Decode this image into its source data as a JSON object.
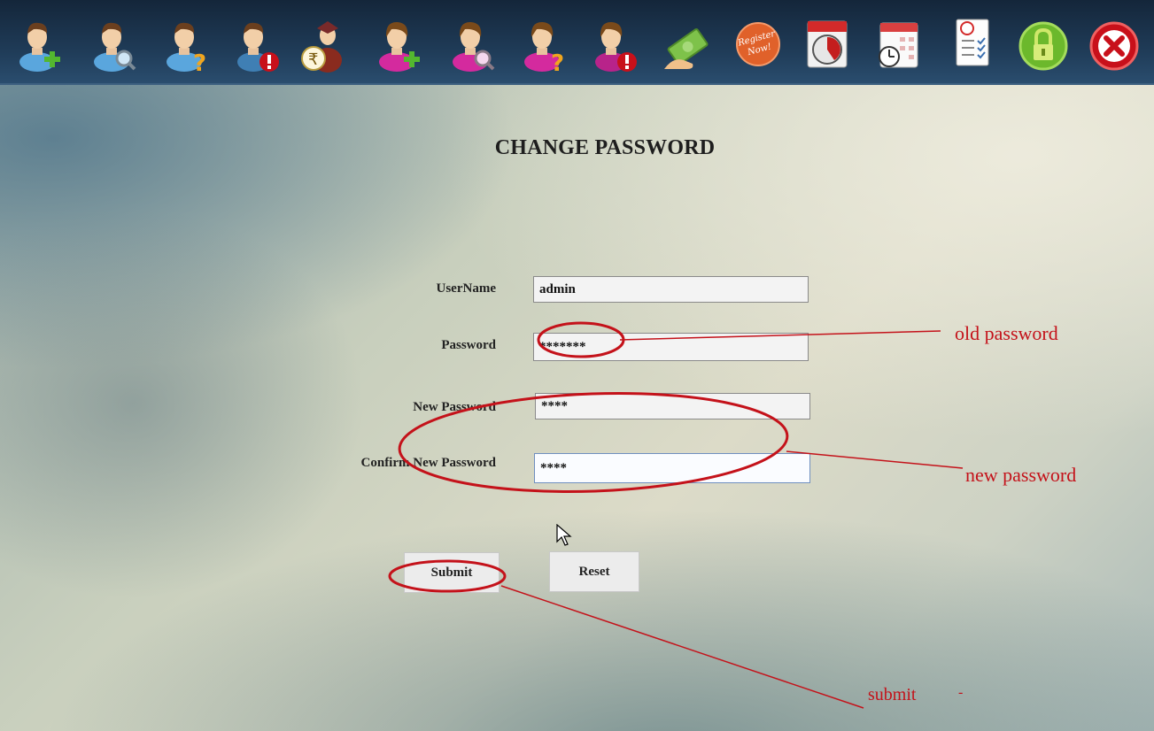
{
  "toolbar": {
    "icons": [
      "add-student-icon",
      "search-student-icon",
      "student-help-icon",
      "delete-student-icon",
      "student-fee-icon",
      "add-staff-icon",
      "search-staff-icon",
      "staff-help-icon",
      "delete-staff-icon",
      "payment-icon",
      "register-new-icon",
      "calendar-clock-icon",
      "schedule-icon",
      "report-checklist-icon",
      "lock-icon",
      "close-icon"
    ],
    "register_badge_text": "Register Now!",
    "colors": {
      "bar": "#1f3b57",
      "green_plus": "#53b72f",
      "red_badge": "#c8101a",
      "orange_badge": "#e0612a"
    }
  },
  "form": {
    "title": "CHANGE PASSWORD",
    "username_label": "UserName",
    "username_value": "admin",
    "password_label": "Password",
    "password_value": "*******",
    "new_password_label": "New Password",
    "new_password_value": "****",
    "confirm_password_label": "Confirm New Password",
    "confirm_password_value": "****",
    "submit_label": "Submit",
    "reset_label": "Reset"
  },
  "annotations": {
    "old_password": "old password",
    "new_password": "new password",
    "submit": "submit",
    "dash": "-",
    "color": "#c4121a"
  }
}
